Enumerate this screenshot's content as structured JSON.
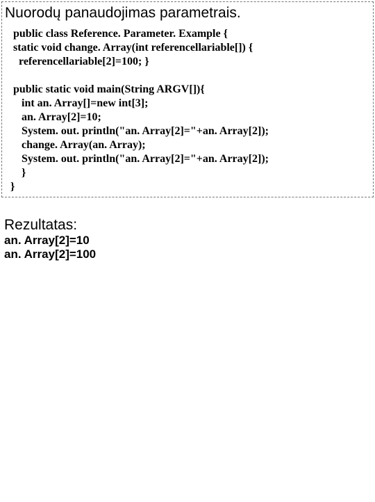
{
  "title": "Nuorodų panaudojimas parametrais.",
  "code": " public class Reference. Parameter. Example {\n static void change. Array(int referencellariable[]) {\n   referencellariable[2]=100; }\n\n public static void main(String ARGV[]){\n    int an. Array[]=new int[3];\n    an. Array[2]=10;\n    System. out. println(\"an. Array[2]=\"+an. Array[2]);\n    change. Array(an. Array);\n    System. out. println(\"an. Array[2]=\"+an. Array[2]);\n    }\n}",
  "result_title": "Rezultatas:",
  "result_line1": "an. Array[2]=10",
  "result_line2": "an. Array[2]=100"
}
